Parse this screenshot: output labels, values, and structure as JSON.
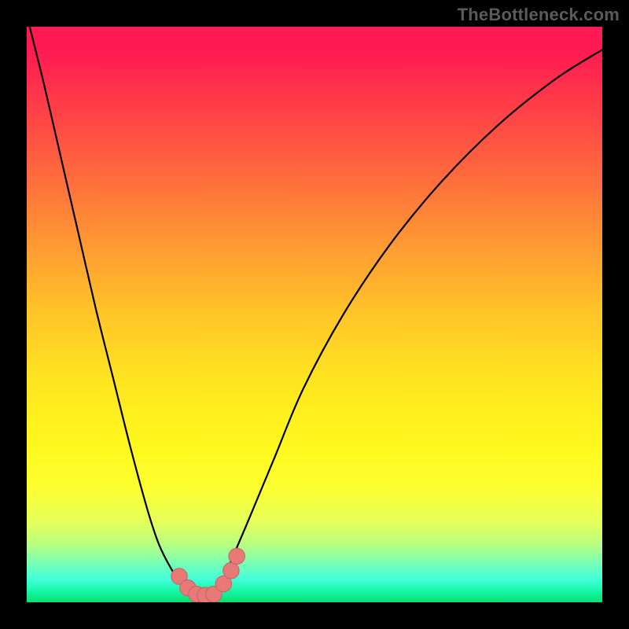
{
  "watermark": "TheBottleneck.com",
  "colors": {
    "background": "#000000",
    "curve_stroke": "#000000",
    "marker_fill": "#e77a77",
    "marker_stroke": "#c46361"
  },
  "chart_data": {
    "type": "line",
    "title": "",
    "xlabel": "",
    "ylabel": "",
    "xlim": [
      0,
      100
    ],
    "ylim": [
      0,
      100
    ],
    "grid": false,
    "series": [
      {
        "name": "curve",
        "x": [
          0,
          3,
          6,
          9,
          12,
          15,
          18,
          21,
          23,
          25,
          27,
          29,
          30,
          31,
          32,
          33,
          34,
          35,
          38,
          43,
          48,
          55,
          63,
          72,
          82,
          92,
          100
        ],
        "y": [
          102,
          90,
          77,
          64,
          51,
          39,
          27,
          16,
          10,
          6,
          3,
          1.5,
          1.2,
          1.2,
          1.5,
          2.2,
          3.5,
          6,
          13,
          25,
          37,
          50,
          62,
          73,
          83,
          91,
          96
        ]
      }
    ],
    "markers": [
      {
        "x": 26.5,
        "y": 4.5,
        "r": 1.4
      },
      {
        "x": 28.0,
        "y": 2.5,
        "r": 1.4
      },
      {
        "x": 29.5,
        "y": 1.4,
        "r": 1.4
      },
      {
        "x": 31.0,
        "y": 1.2,
        "r": 1.4
      },
      {
        "x": 32.5,
        "y": 1.4,
        "r": 1.4
      },
      {
        "x": 34.2,
        "y": 3.2,
        "r": 1.4
      },
      {
        "x": 35.5,
        "y": 5.5,
        "r": 1.4
      },
      {
        "x": 36.5,
        "y": 8.0,
        "r": 1.4
      }
    ]
  }
}
